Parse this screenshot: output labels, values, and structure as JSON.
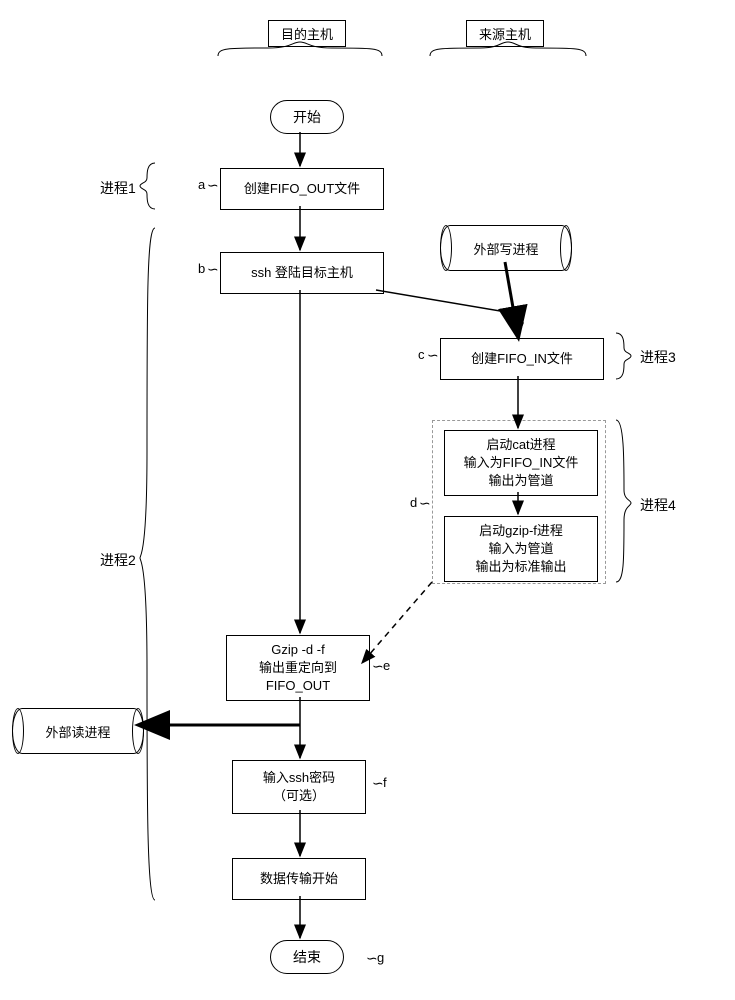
{
  "headers": {
    "dest": "目的主机",
    "src": "来源主机"
  },
  "start": "开始",
  "steps": {
    "a": "创建FIFO_OUT文件",
    "b": "ssh 登陆目标主机",
    "c": "创建FIFO_IN文件",
    "d1": "启动cat进程",
    "d2": "输入为FIFO_IN文件",
    "d3": "输出为管道",
    "d4": "启动gzip-f进程",
    "d5": "输入为管道",
    "d6": "输出为标准输出",
    "e1": "Gzip -d -f",
    "e2": "输出重定向到",
    "e3": "FIFO_OUT",
    "f1": "输入ssh密码",
    "f2": "（可选）",
    "g": "数据传输开始"
  },
  "end": "结束",
  "processes": {
    "p1": "进程1",
    "p2": "进程2",
    "p3": "进程3",
    "p4": "进程4",
    "ext_write": "外部写进程",
    "ext_read": "外部读进程"
  },
  "labels": {
    "a": "a",
    "b": "b",
    "c": "c",
    "d": "d",
    "e": "e",
    "f": "f",
    "g": "g"
  },
  "chart_data": {
    "type": "flowchart",
    "swimlanes": [
      "目的主机",
      "来源主机"
    ],
    "nodes": [
      {
        "id": "start",
        "type": "terminator",
        "lane": "目的主机",
        "label": "开始"
      },
      {
        "id": "a",
        "type": "process",
        "lane": "目的主机",
        "label": "创建FIFO_OUT文件",
        "group": "进程1"
      },
      {
        "id": "b",
        "type": "process",
        "lane": "目的主机",
        "label": "ssh 登陆目标主机",
        "group": "进程2"
      },
      {
        "id": "ext_write",
        "type": "external",
        "lane": "来源主机",
        "label": "外部写进程"
      },
      {
        "id": "c",
        "type": "process",
        "lane": "来源主机",
        "label": "创建FIFO_IN文件",
        "group": "进程3"
      },
      {
        "id": "d_cat",
        "type": "process",
        "lane": "来源主机",
        "label": "启动cat进程 / 输入为FIFO_IN文件 / 输出为管道",
        "group": "进程4"
      },
      {
        "id": "d_gzip",
        "type": "process",
        "lane": "来源主机",
        "label": "启动gzip-f进程 / 输入为管道 / 输出为标准输出",
        "group": "进程4"
      },
      {
        "id": "e",
        "type": "process",
        "lane": "目的主机",
        "label": "Gzip -d -f / 输出重定向到 / FIFO_OUT",
        "group": "进程2"
      },
      {
        "id": "ext_read",
        "type": "external",
        "lane": "目的主机",
        "label": "外部读进程"
      },
      {
        "id": "f",
        "type": "process",
        "lane": "目的主机",
        "label": "输入ssh密码（可选）",
        "group": "进程2"
      },
      {
        "id": "g",
        "type": "process",
        "lane": "目的主机",
        "label": "数据传输开始",
        "group": "进程2"
      },
      {
        "id": "end",
        "type": "terminator",
        "lane": "目的主机",
        "label": "结束"
      }
    ],
    "edges": [
      {
        "from": "start",
        "to": "a",
        "style": "solid"
      },
      {
        "from": "a",
        "to": "b",
        "style": "solid"
      },
      {
        "from": "b",
        "to": "e",
        "style": "solid"
      },
      {
        "from": "b",
        "to": "c",
        "style": "solid"
      },
      {
        "from": "ext_write",
        "to": "c",
        "style": "solid_bold"
      },
      {
        "from": "c",
        "to": "d_cat",
        "style": "solid"
      },
      {
        "from": "d_cat",
        "to": "d_gzip",
        "style": "solid"
      },
      {
        "from": "d_gzip",
        "to": "e",
        "style": "dashed"
      },
      {
        "from": "e",
        "to": "ext_read",
        "style": "solid_bold"
      },
      {
        "from": "e",
        "to": "f",
        "style": "solid"
      },
      {
        "from": "f",
        "to": "g",
        "style": "solid"
      },
      {
        "from": "g",
        "to": "end",
        "style": "solid"
      }
    ]
  }
}
